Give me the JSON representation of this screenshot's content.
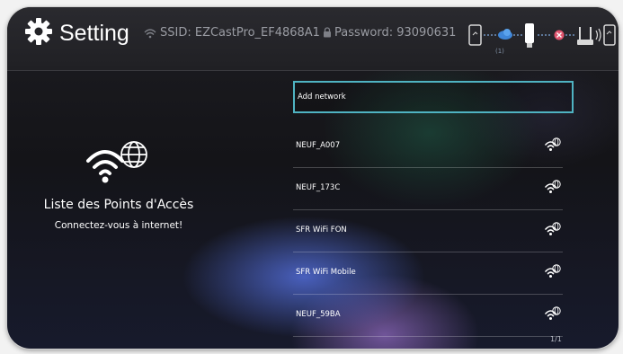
{
  "header": {
    "title": "Setting",
    "ssid": "SSID: EZCastPro_EF4868A1",
    "password": "Password: 93090631",
    "connection_count": "(1)"
  },
  "sidebar": {
    "title": "Liste des Points d'Accès",
    "subtitle": "Connectez-vous à internet!"
  },
  "networks": [
    {
      "name": "Add network"
    },
    {
      "name": "NEUF_A007"
    },
    {
      "name": "NEUF_173C"
    },
    {
      "name": "SFR WiFi FON"
    },
    {
      "name": "SFR WiFi Mobile"
    },
    {
      "name": "NEUF_59BA"
    }
  ],
  "pagination": {
    "label": "1/1"
  },
  "colors": {
    "accent": "#4fb3c2",
    "header_bg": "#232327",
    "disconnected": "#e0556e"
  },
  "icons": [
    "gear-icon",
    "wifi-icon",
    "lock-icon",
    "wifi-globe-icon",
    "phone-icon",
    "dongle-icon",
    "router-icon",
    "disconnect-icon"
  ]
}
